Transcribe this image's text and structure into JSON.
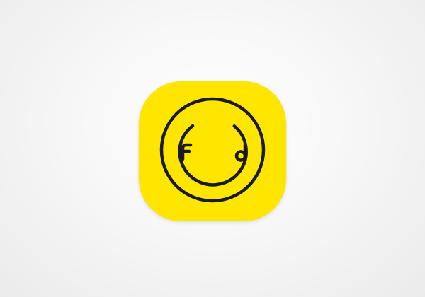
{
  "app_icon": {
    "name": "foodie-app-icon",
    "background_color": "#FFE600",
    "stroke_color": "#1A1A1A"
  }
}
